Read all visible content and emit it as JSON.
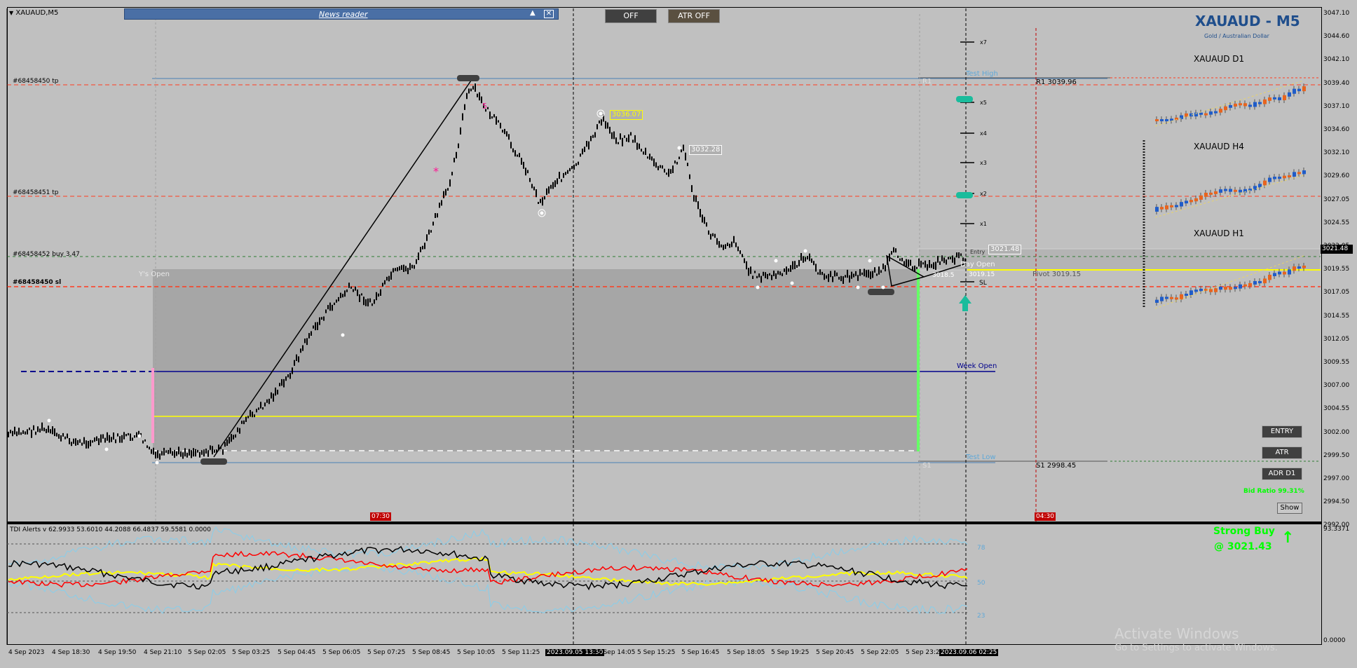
{
  "window": {
    "title": "XAUAUD,M5"
  },
  "news": {
    "label": "News reader",
    "up_icon": "triangle-up-icon",
    "close_icon": "close-box-icon"
  },
  "toolbar": {
    "off_label": "OFF",
    "atr_off_label": "ATR OFF"
  },
  "header": {
    "symbol_title": "XAUAUD - M5",
    "subtitle": "Gold / Australian Dollar"
  },
  "mini_charts": {
    "d1": "XAUAUD D1",
    "h4": "XAUAUD H4",
    "h1": "XAUAUD H1"
  },
  "orders": {
    "tp1": "#68458450 tp",
    "tp2": "#68458451 tp",
    "buy": "#68458452 buy 3.47",
    "sl": "#68458450 sl"
  },
  "levels": {
    "ys_open": "Y's Open",
    "test_high": "Test High",
    "test_low": "Test Low",
    "r1": "R1 3039.96",
    "s1": "S1 2998.45",
    "pivot": "Pivot 3019.15",
    "week_open": "Week Open",
    "day_open": "Day Open",
    "entry": "Entry",
    "sl": "SL",
    "r1_short": "R1",
    "s1_short": "S1"
  },
  "tp_ladder": [
    "x7",
    "x5",
    "x4",
    "x3",
    "x2",
    "x1"
  ],
  "price_tags": {
    "p1": "3036.07",
    "p2": "3032.28",
    "p3": "3021.48",
    "p4": "3018.5",
    "p5": "3019.15",
    "fr1": "5",
    "current": "3021.48"
  },
  "price_axis": [
    "3047.10",
    "3044.60",
    "3042.10",
    "3039.40",
    "3037.10",
    "3034.60",
    "3032.10",
    "3029.60",
    "3027.05",
    "3024.55",
    "3022.05",
    "3019.55",
    "3017.05",
    "3014.55",
    "3012.05",
    "3009.55",
    "3007.00",
    "3004.55",
    "3002.00",
    "2999.50",
    "2997.00",
    "2994.50",
    "2992.00"
  ],
  "tdi": {
    "header": "TDI Alerts v 62.9933 53.6010 44.2088 66.4837 59.5581 0.0000",
    "axis_top": "93.3371",
    "axis_bottom": "0.0000",
    "level_78": "78",
    "level_50": "50",
    "level_23": "23"
  },
  "signal": {
    "title": "Strong Buy",
    "price": "@ 3021.43",
    "arrow_icon": "up-arrow-icon"
  },
  "side_buttons": {
    "entry": "ENTRY",
    "atr": "ATR",
    "adr": "ADR D1",
    "show": "Show"
  },
  "bid_ratio": "Bid Ratio 99.31%",
  "session_tags": {
    "t1": "07:30",
    "t2": "04:30"
  },
  "time_axis": [
    "4 Sep 2023",
    "4 Sep 18:30",
    "4 Sep 19:50",
    "4 Sep 21:10",
    "5 Sep 02:05",
    "5 Sep 03:25",
    "5 Sep 04:45",
    "5 Sep 06:05",
    "5 Sep 07:25",
    "5 Sep 08:45",
    "5 Sep 10:05",
    "5 Sep 11:25",
    "2023.09.05 13:30",
    "5 Sep 14:05",
    "5 Sep 15:25",
    "5 Sep 16:45",
    "5 Sep 18:05",
    "5 Sep 19:25",
    "5 Sep 20:45",
    "5 Sep 22:05",
    "5 Sep 23:25",
    "2023.09.06 02:25"
  ],
  "watermark": {
    "line1": "Activate Windows",
    "line2": "Go to Settings to activate Windows."
  },
  "colors": {
    "chart_bg": "#c0c0c0",
    "zone": "#a5a5a5",
    "week_open": "#00008b",
    "pivot": "#ffff00",
    "red_dash": "#ff3b1f",
    "green": "#00ff00",
    "title": "#1f4e8c"
  }
}
